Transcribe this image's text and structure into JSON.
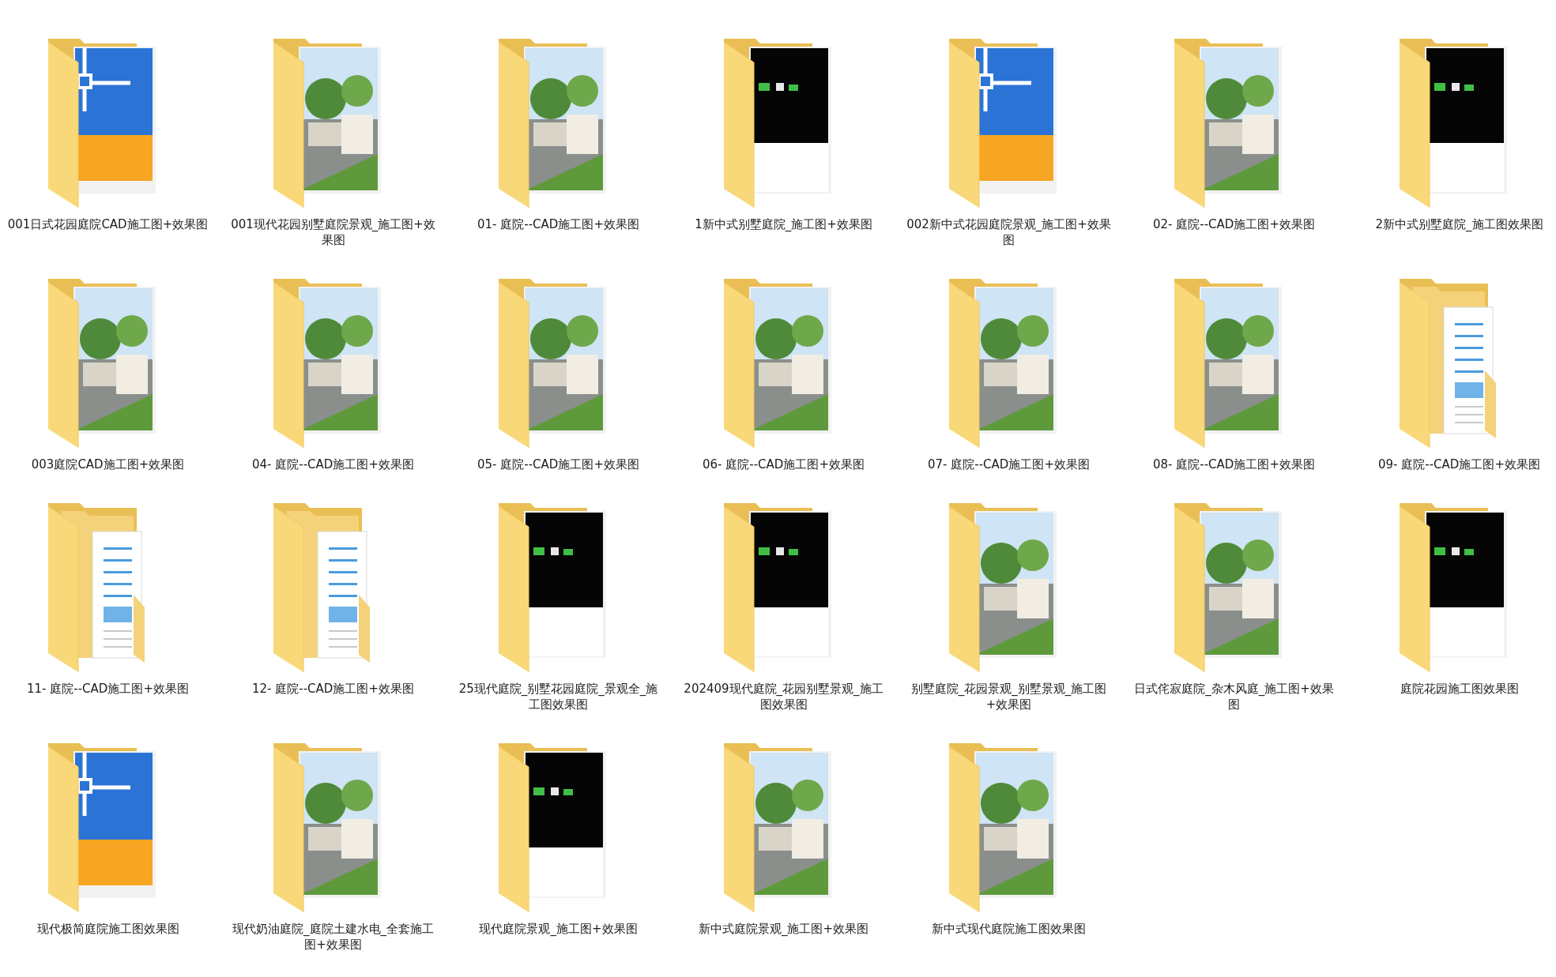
{
  "folders": [
    {
      "name": "001日式花园庭院CAD施工图+效果图",
      "kind": "dwg"
    },
    {
      "name": "001现代花园别墅庭院景观_施工图+效果图",
      "kind": "photo"
    },
    {
      "name": "01- 庭院--CAD施工图+效果图",
      "kind": "photo"
    },
    {
      "name": "1新中式别墅庭院_施工图+效果图",
      "kind": "dark"
    },
    {
      "name": "002新中式花园庭院景观_施工图+效果图",
      "kind": "dwg"
    },
    {
      "name": "02- 庭院--CAD施工图+效果图",
      "kind": "photo"
    },
    {
      "name": "2新中式别墅庭院_施工图效果图",
      "kind": "dark"
    },
    {
      "name": "003庭院CAD施工图+效果图",
      "kind": "photo"
    },
    {
      "name": "04- 庭院--CAD施工图+效果图",
      "kind": "photo"
    },
    {
      "name": "05- 庭院--CAD施工图+效果图",
      "kind": "photo"
    },
    {
      "name": "06- 庭院--CAD施工图+效果图",
      "kind": "photo"
    },
    {
      "name": "07- 庭院--CAD施工图+效果图",
      "kind": "photo"
    },
    {
      "name": "08- 庭院--CAD施工图+效果图",
      "kind": "photo"
    },
    {
      "name": "09- 庭院--CAD施工图+效果图",
      "kind": "document"
    },
    {
      "name": "11- 庭院--CAD施工图+效果图",
      "kind": "document"
    },
    {
      "name": "12- 庭院--CAD施工图+效果图",
      "kind": "document"
    },
    {
      "name": "25现代庭院_别墅花园庭院_景观全_施工图效果图",
      "kind": "dark"
    },
    {
      "name": "202409现代庭院_花园别墅景观_施工图效果图",
      "kind": "dark"
    },
    {
      "name": "别墅庭院_花园景观_别墅景观_施工图+效果图",
      "kind": "photo"
    },
    {
      "name": "日式侘寂庭院_杂木风庭_施工图+效果图",
      "kind": "photo"
    },
    {
      "name": "庭院花园施工图效果图",
      "kind": "dark"
    },
    {
      "name": "现代极简庭院施工图效果图",
      "kind": "dwg"
    },
    {
      "name": "现代奶油庭院_庭院土建水电_全套施工图+效果图",
      "kind": "photo"
    },
    {
      "name": "现代庭院景观_施工图+效果图",
      "kind": "dark"
    },
    {
      "name": "新中式庭院景观_施工图+效果图",
      "kind": "photo"
    },
    {
      "name": "新中式现代庭院施工图效果图",
      "kind": "photo"
    }
  ]
}
